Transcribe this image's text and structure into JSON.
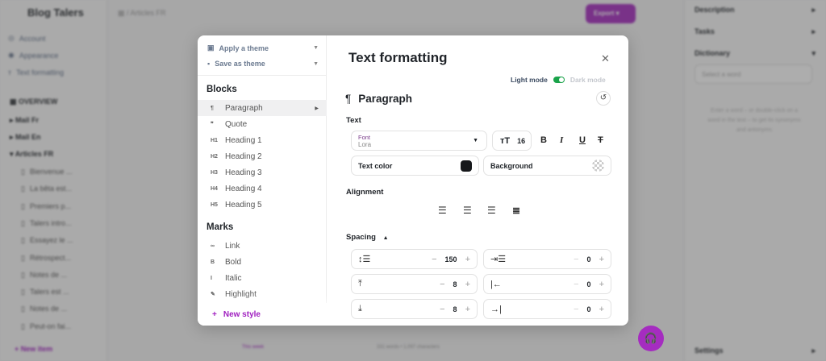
{
  "background": {
    "app_title": "Blog Talers",
    "settings_nav": [
      "Account",
      "Appearance",
      "Text formatting"
    ],
    "overview_label": "OVERVIEW",
    "tree": [
      "Mail Fr",
      "Mail En",
      "Articles FR"
    ],
    "docs": [
      "Bienvenue ...",
      "La bêta est...",
      "Premiers p...",
      "Talers intro...",
      "Essayez le ...",
      "Rétrospect...",
      "Notes de ...",
      "Talers est ...",
      "Notes de ...",
      "Peut-on fai..."
    ],
    "new_item": "New item",
    "breadcrumb": "Articles FR",
    "export": "Export",
    "right_panel": {
      "description": "Description",
      "tasks": "Tasks",
      "dictionary": "Dictionary",
      "search_placeholder": "Select a word",
      "hint": "Enter a word – or double-click on a word in the text – to get its synonyms and antonyms",
      "settings": "Settings"
    },
    "footer": {
      "filter": "This week",
      "stats": "331 words • 1,097 characters"
    }
  },
  "modal": {
    "apply_theme": "Apply a theme",
    "save_theme": "Save as theme",
    "blocks_label": "Blocks",
    "blocks": [
      {
        "icon": "¶",
        "label": "Paragraph"
      },
      {
        "icon": "❞",
        "label": "Quote"
      },
      {
        "icon": "H1",
        "label": "Heading 1"
      },
      {
        "icon": "H2",
        "label": "Heading 2"
      },
      {
        "icon": "H3",
        "label": "Heading 3"
      },
      {
        "icon": "H4",
        "label": "Heading 4"
      },
      {
        "icon": "H5",
        "label": "Heading 5"
      }
    ],
    "marks_label": "Marks",
    "marks": [
      {
        "icon": "∞",
        "label": "Link"
      },
      {
        "icon": "B",
        "label": "Bold"
      },
      {
        "icon": "I",
        "label": "Italic"
      },
      {
        "icon": "✎",
        "label": "Highlight"
      }
    ],
    "new_style": "New style",
    "title": "Text formatting",
    "light_mode": "Light mode",
    "dark_mode": "Dark mode",
    "block_title": "Paragraph",
    "text_label": "Text",
    "font_label": "Font",
    "font_value": "Lora",
    "font_size": "16",
    "text_color_label": "Text color",
    "text_color": "#16181b",
    "background_label": "Background",
    "alignment_label": "Alignment",
    "spacing_label": "Spacing",
    "spacing": {
      "line_height": "150",
      "indent": "0",
      "space_before": "8",
      "margin_left": "0",
      "space_after": "8",
      "margin_right": "0"
    }
  },
  "accent": "#a020c0"
}
